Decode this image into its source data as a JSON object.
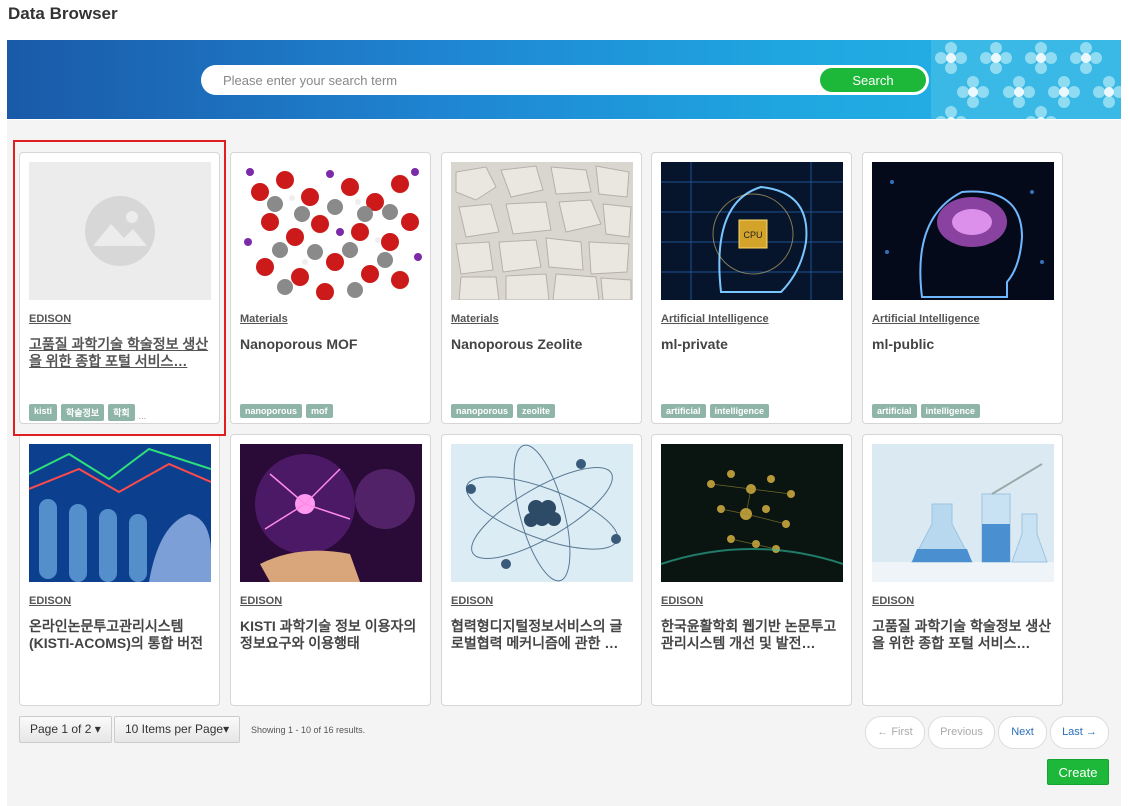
{
  "page": {
    "title": "Data Browser"
  },
  "search": {
    "placeholder": "Please enter your search term",
    "button_label": "Search"
  },
  "cards": [
    {
      "category": "EDISON",
      "title": "고품질 과학기술 학술정보 생산을 위한 종합 포털 서비스…",
      "tags": [
        "kisti",
        "학술정보",
        "학회"
      ],
      "more": "...",
      "thumb": "placeholder-image-icon"
    },
    {
      "category": "Materials",
      "title": "Nanoporous MOF",
      "tags": [
        "nanoporous",
        "mof"
      ],
      "thumb": "mof-molecule-image"
    },
    {
      "category": "Materials",
      "title": "Nanoporous Zeolite",
      "tags": [
        "nanoporous",
        "zeolite"
      ],
      "thumb": "zeolite-rocks-image"
    },
    {
      "category": "Artificial Intelligence",
      "title": "ml-private",
      "tags": [
        "artificial",
        "intelligence"
      ],
      "thumb": "ai-chip-head-image"
    },
    {
      "category": "Artificial Intelligence",
      "title": "ml-public",
      "tags": [
        "artificial",
        "intelligence"
      ],
      "thumb": "ai-brain-head-image"
    },
    {
      "category": "EDISON",
      "title": "온라인논문투고관리시스템(KISTI-ACOMS)의 통합 버전 …",
      "tags": [],
      "thumb": "test-tubes-image"
    },
    {
      "category": "EDISON",
      "title": "KISTI 과학기술 정보 이용자의 정보요구와 이용행태",
      "tags": [],
      "thumb": "plasma-ball-image"
    },
    {
      "category": "EDISON",
      "title": "협력형디지털정보서비스의 글로벌협력 메커니즘에 관한 …",
      "tags": [],
      "thumb": "atom-model-image"
    },
    {
      "category": "EDISON",
      "title": "한국윤활학회 웹기반 논문투고관리시스템 개선 및 발전…",
      "tags": [],
      "thumb": "gold-network-image"
    },
    {
      "category": "EDISON",
      "title": "고품질 과학기술 학술정보 생산을 위한 종합 포털 서비스…",
      "tags": [],
      "thumb": "lab-flasks-image"
    }
  ],
  "pagination": {
    "page_label": "Page 1 of 2",
    "items_label": "10 Items per Page",
    "results": "Showing 1 - 10 of 16 results.",
    "first": "← First",
    "previous": "Previous",
    "next": "Next",
    "last": "Last →"
  },
  "create_label": "Create",
  "colors": {
    "accent_green": "#1db83a",
    "banner_blue": "#1f86d3",
    "tag_bg": "#8fb4a8",
    "selected_border": "#e02020",
    "link_blue": "#2a6fb5"
  }
}
